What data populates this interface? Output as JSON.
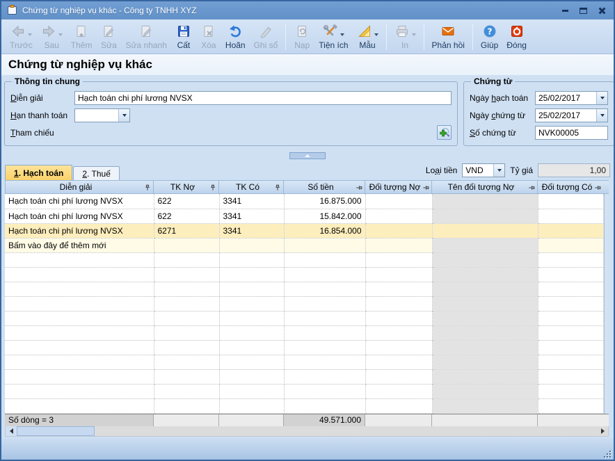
{
  "window": {
    "title": "Chứng từ nghiệp vụ khác - Công ty TNHH XYZ"
  },
  "toolbar": {
    "items": [
      {
        "label": "Trước",
        "enabled": false,
        "dropdown": true
      },
      {
        "label": "Sau",
        "enabled": false,
        "dropdown": true
      },
      {
        "label": "Thêm",
        "enabled": false
      },
      {
        "label": "Sửa",
        "enabled": false
      },
      {
        "label": "Sửa nhanh",
        "enabled": false
      },
      {
        "label": "Cất",
        "enabled": true
      },
      {
        "label": "Xóa",
        "enabled": false
      },
      {
        "label": "Hoãn",
        "enabled": true
      },
      {
        "label": "Ghi sổ",
        "enabled": false
      },
      {
        "label": "Nạp",
        "enabled": false
      },
      {
        "label": "Tiện ích",
        "enabled": true,
        "dropdown": true
      },
      {
        "label": "Mẫu",
        "enabled": true,
        "dropdown": true
      },
      {
        "label": "In",
        "enabled": false,
        "dropdown": true
      },
      {
        "label": "Phản hồi",
        "enabled": true
      },
      {
        "label": "Giúp",
        "enabled": true
      },
      {
        "label": "Đóng",
        "enabled": true
      }
    ]
  },
  "page": {
    "title": "Chứng từ nghiệp vụ khác"
  },
  "general_info": {
    "legend": "Thông tin chung",
    "dien_giai_label": {
      "text": "Diễn giải",
      "accel": 0
    },
    "dien_giai_value": "Hạch toán chi phí lương NVSX",
    "han_thanh_toan_label": {
      "text": "Hạn thanh toán",
      "accel": 0
    },
    "han_thanh_toan_value": "",
    "tham_chieu_label": {
      "text": "Tham chiếu",
      "accel": 0
    }
  },
  "chung_tu": {
    "legend": "Chứng từ",
    "ngay_hach_toan_label": {
      "text": "Ngày hạch toán",
      "accel": 5
    },
    "ngay_hach_toan_value": "25/02/2017",
    "ngay_chung_tu_label": {
      "text": "Ngày chứng từ",
      "accel": 5
    },
    "ngay_chung_tu_value": "25/02/2017",
    "so_chung_tu_label": {
      "text": "Số chứng từ",
      "accel": 0
    },
    "so_chung_tu_value": "NVK00005"
  },
  "tabs": [
    {
      "label": {
        "text": "1. Hạch toán",
        "accel": 0
      },
      "active": true
    },
    {
      "label": {
        "text": "2. Thuế",
        "accel": 0
      },
      "active": false
    }
  ],
  "currency": {
    "loai_tien_label": {
      "text": "Loại tiền",
      "accel": 2
    },
    "loai_tien_value": "VND",
    "ty_gia_label": {
      "text": "Tỷ giá",
      "accel": 3
    },
    "ty_gia_value": "1,00"
  },
  "grid": {
    "columns": [
      "Diễn giải",
      "TK Nợ",
      "TK Có",
      "Số tiền",
      "Đối tượng Nợ",
      "Tên đối tượng Nợ",
      "Đối tượng Có"
    ],
    "rows": [
      {
        "dien_giai": "Hạch toán chi phí lương NVSX",
        "tk_no": "622",
        "tk_co": "3341",
        "so_tien": "16.875.000",
        "selected": false
      },
      {
        "dien_giai": "Hạch toán chi phí lương NVSX",
        "tk_no": "622",
        "tk_co": "3341",
        "so_tien": "15.842.000",
        "selected": false
      },
      {
        "dien_giai": "Hạch toán chi phí lương NVSX",
        "tk_no": "6271",
        "tk_co": "3341",
        "so_tien": "16.854.000",
        "selected": true
      }
    ],
    "new_row_label": "Bấm vào đây để thêm mới",
    "footer": {
      "row_count": "Số dòng = 3",
      "total": "49.571.000"
    }
  },
  "colors": {
    "titlebar": "#6191c8",
    "active_tab": "#fbd26a",
    "selected_row": "#fdeebd",
    "new_row": "#fffbe6",
    "disabled_column": "#e3e3e3",
    "feedback_orange": "#e8700f",
    "close_red": "#e23b0e"
  }
}
